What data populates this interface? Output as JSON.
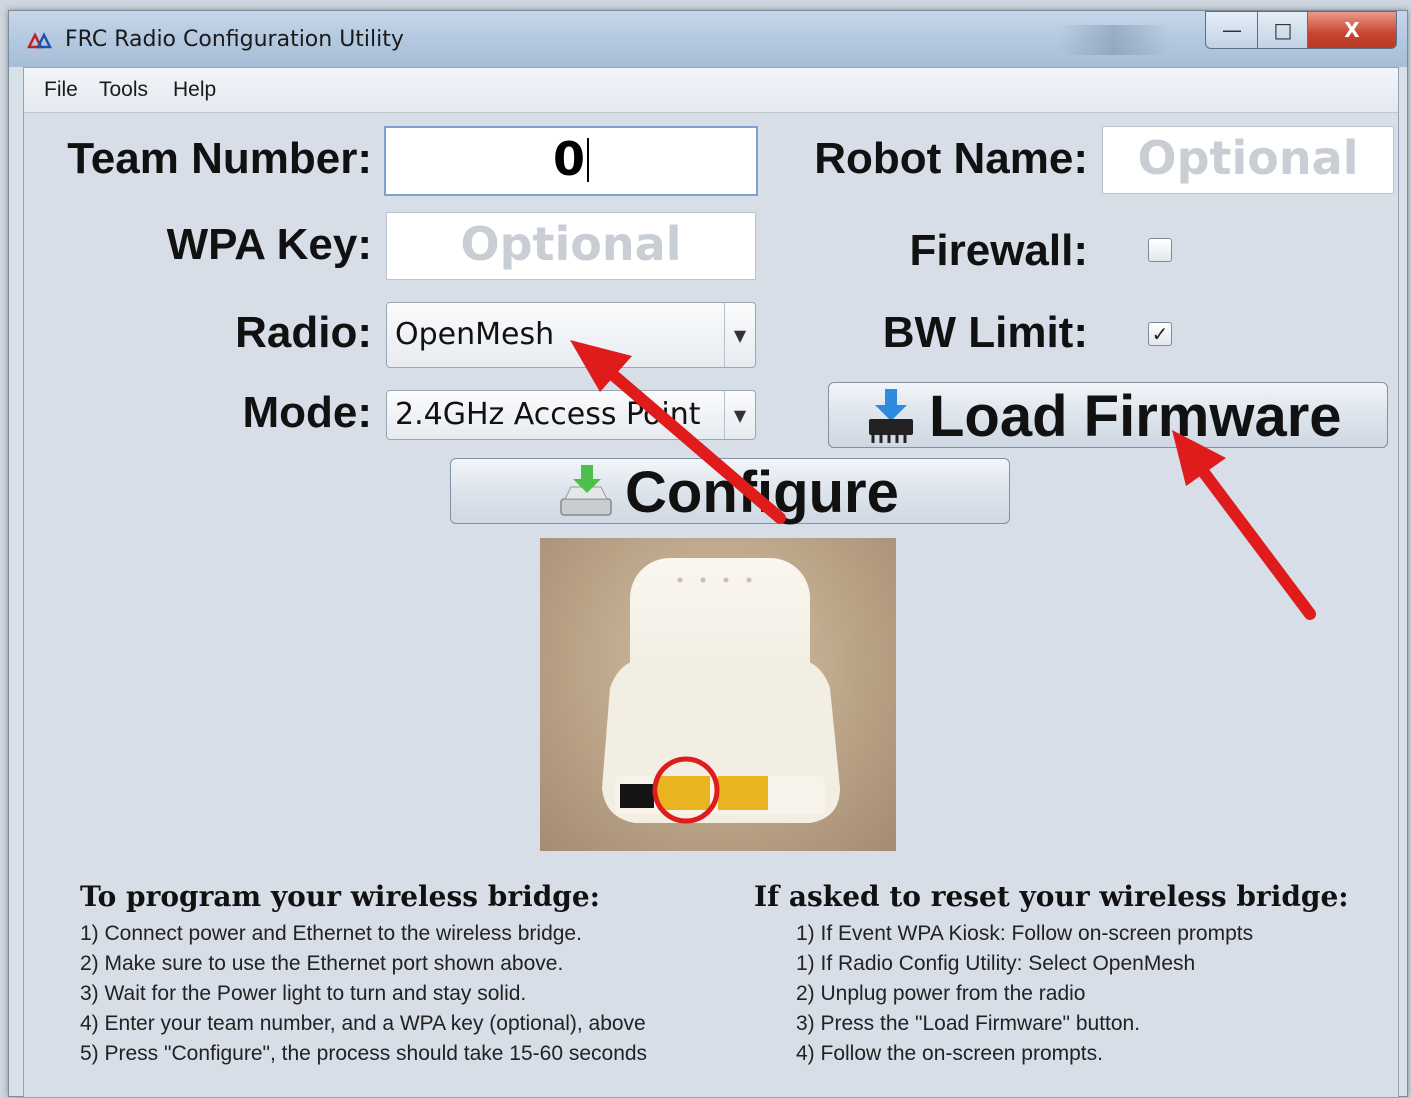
{
  "window": {
    "title": "FRC Radio Configuration Utility",
    "controls": {
      "minimize": "—",
      "maximize": "□",
      "close": "X"
    }
  },
  "menu": [
    "File",
    "Tools",
    "Help"
  ],
  "form": {
    "team_number_label": "Team Number:",
    "team_number_value": "0",
    "robot_name_label": "Robot Name:",
    "robot_name_placeholder": "Optional",
    "wpa_key_label": "WPA Key:",
    "wpa_key_placeholder": "Optional",
    "firewall_label": "Firewall:",
    "firewall_checked": false,
    "radio_label": "Radio:",
    "radio_value": "OpenMesh",
    "bw_limit_label": "BW Limit:",
    "bw_limit_checked": true,
    "mode_label": "Mode:",
    "mode_value": "2.4GHz Access Point"
  },
  "buttons": {
    "load_firmware": "Load Firmware",
    "configure": "Configure"
  },
  "instructions_left": {
    "heading": "To program your wireless bridge:",
    "steps": [
      "1) Connect power and Ethernet to the wireless bridge.",
      "2) Make sure to use the Ethernet port shown above.",
      "3) Wait for the Power light to turn and stay solid.",
      "4) Enter your team number, and a WPA key (optional), above",
      "5) Press \"Configure\", the process should take 15-60 seconds"
    ]
  },
  "instructions_right": {
    "heading": "If asked to reset your wireless bridge:",
    "steps": [
      "1) If Event WPA Kiosk: Follow on-screen prompts",
      "1) If Radio Config Utility: Select OpenMesh",
      "2) Unplug power from the radio",
      "3) Press the \"Load Firmware\" button.",
      "4) Follow the on-screen prompts."
    ]
  },
  "colors": {
    "annotation_arrow": "#e01b1b",
    "placeholder": "#c9ced4",
    "port_yellow": "#e8b520"
  }
}
